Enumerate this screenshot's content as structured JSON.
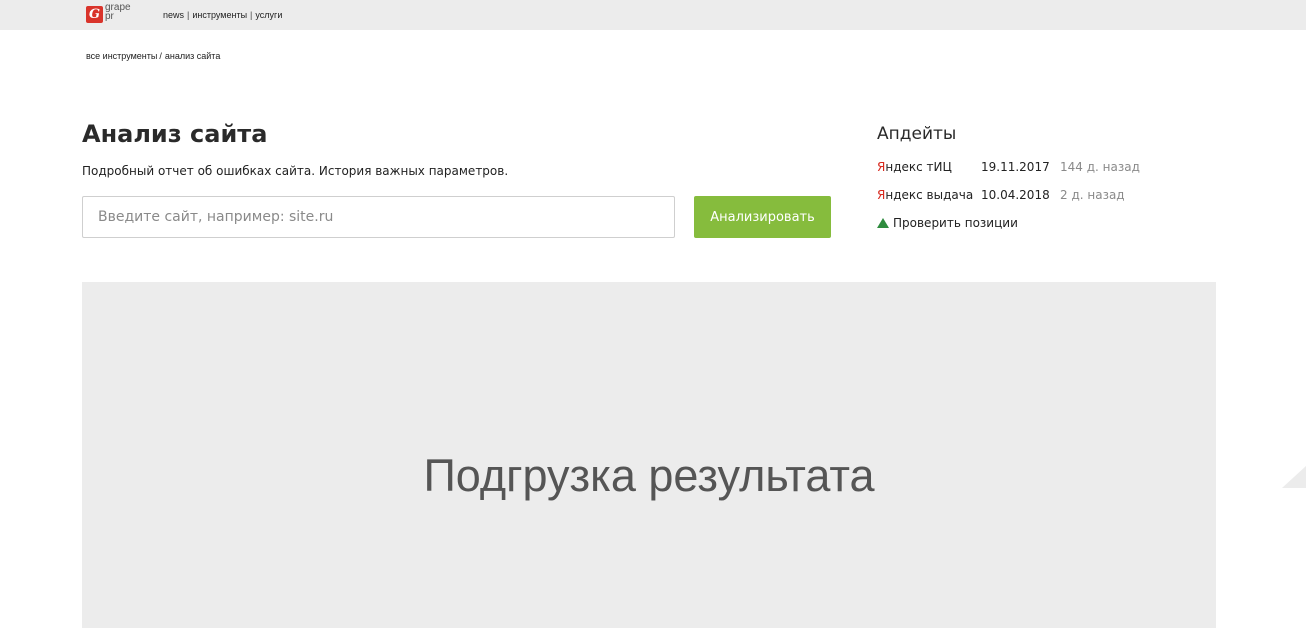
{
  "header": {
    "logo_line1": "grape",
    "logo_line2": "pr",
    "logo_icon": "grape-pr-logo-icon",
    "nav": [
      "news",
      "инструменты",
      "услуги"
    ],
    "nav_separator": "|"
  },
  "breadcrumb": {
    "items": [
      "все инструменты",
      "анализ сайта"
    ],
    "separator": "/"
  },
  "main": {
    "title": "Анализ сайта",
    "subtitle": "Подробный отчет об ошибках сайта. История важных параметров.",
    "input_placeholder": "Введите сайт, например: site.ru",
    "input_value": "",
    "button_label": "Анализировать"
  },
  "updates": {
    "title": "Апдейты",
    "rows": [
      {
        "label_first": "Я",
        "label_rest": "ндекс тИЦ",
        "date": "19.11.2017",
        "ago": "144 д. назад"
      },
      {
        "label_first": "Я",
        "label_rest": "ндекс выдача",
        "date": "10.04.2018",
        "ago": "2 д. назад"
      }
    ],
    "check_link": "Проверить позиции",
    "check_icon": "green-triangle-icon"
  },
  "loader": {
    "text": "Подгрузка результата"
  },
  "colors": {
    "topbar_bg": "#ececec",
    "accent_green": "#86bc3d",
    "yandex_red": "#d72a1f",
    "logo_red": "#d9342b",
    "panel_bg": "#ececec"
  }
}
